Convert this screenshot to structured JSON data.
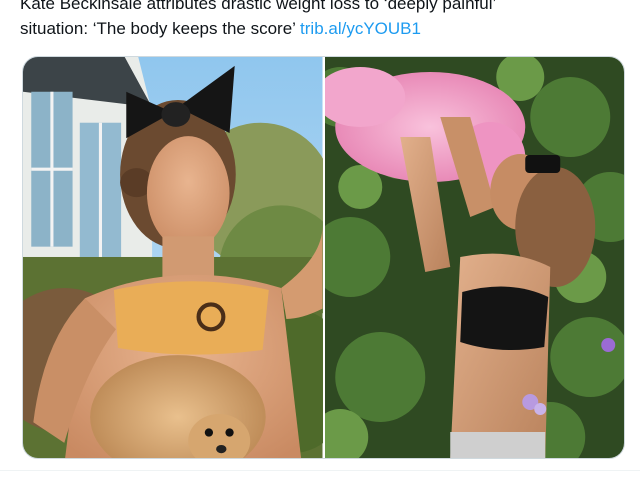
{
  "tweet": {
    "text_line_1": "Kate Beckinsale attributes drastic weight loss to ‘deeply painful’",
    "text_line_2": "situation: ‘The body keeps the score’ ",
    "link_text": "trib.al/ycYOUB1"
  },
  "media": {
    "count": 2,
    "photos": [
      {
        "subject": "woman-in-orange-bandeau-with-pomeranian"
      },
      {
        "subject": "woman-in-black-bandeau-holding-pink-dog"
      }
    ]
  },
  "colors": {
    "text": "#0f1419",
    "link": "#1d9bf0",
    "border": "#cfd9de"
  }
}
